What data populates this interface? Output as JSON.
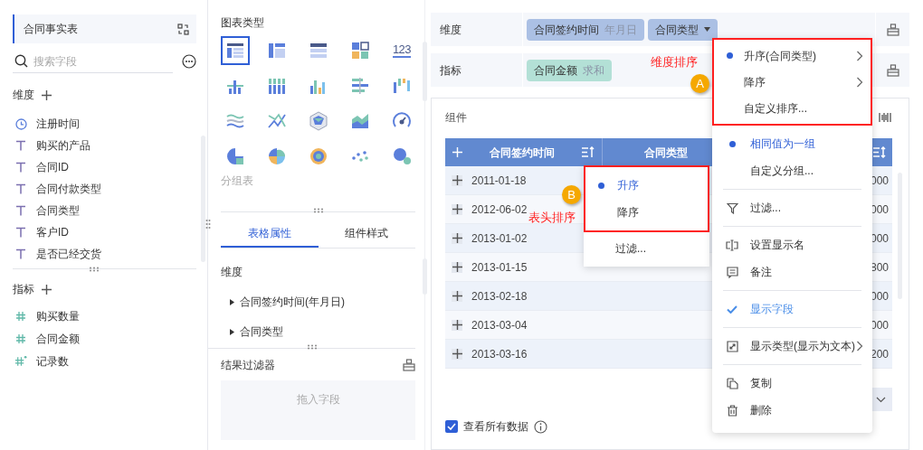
{
  "left_panel": {
    "table_name": "合同事实表",
    "search": {
      "placeholder": "搜索字段"
    },
    "dimensions": {
      "title": "维度",
      "fields": [
        {
          "kind": "date",
          "name": "注册时间"
        },
        {
          "kind": "text",
          "name": "购买的产品"
        },
        {
          "kind": "text",
          "name": "合同ID"
        },
        {
          "kind": "text",
          "name": "合同付款类型"
        },
        {
          "kind": "text",
          "name": "合同类型"
        },
        {
          "kind": "text",
          "name": "客户ID"
        },
        {
          "kind": "text",
          "name": "是否已经交货"
        }
      ]
    },
    "measures": {
      "title": "指标",
      "fields": [
        {
          "kind": "number",
          "name": "购买数量"
        },
        {
          "kind": "number",
          "name": "合同金额"
        },
        {
          "kind": "count",
          "name": "记录数"
        }
      ]
    }
  },
  "chart_types": {
    "title": "图表类型",
    "types": [
      {
        "kind": "table",
        "selected": true
      },
      {
        "kind": "cross-table",
        "selected": false
      },
      {
        "kind": "detail-table",
        "selected": false
      },
      {
        "kind": "kpi-grid",
        "selected": false
      },
      {
        "kind": "number",
        "text": "123",
        "selected": false
      },
      {
        "kind": "grouped-bar",
        "selected": false
      },
      {
        "kind": "stacked-bar",
        "selected": false
      },
      {
        "kind": "multi-bar",
        "selected": false
      },
      {
        "kind": "horizontal-bar",
        "selected": false
      },
      {
        "kind": "waterfall",
        "selected": false
      },
      {
        "kind": "stream",
        "selected": false
      },
      {
        "kind": "line",
        "selected": false
      },
      {
        "kind": "radar",
        "selected": false
      },
      {
        "kind": "area",
        "selected": false
      },
      {
        "kind": "gauge",
        "selected": false
      },
      {
        "kind": "pie",
        "selected": false
      },
      {
        "kind": "rose",
        "selected": false
      },
      {
        "kind": "sunburst",
        "selected": false
      },
      {
        "kind": "scatter",
        "selected": false
      },
      {
        "kind": "bubble",
        "selected": false
      }
    ],
    "caption": "分组表"
  },
  "properties": {
    "tabs": [
      {
        "label": "表格属性",
        "selected": true
      },
      {
        "label": "组件样式",
        "selected": false
      }
    ],
    "section": "维度",
    "fields": [
      "合同签约时间(年月日)",
      "合同类型"
    ]
  },
  "result_filter": {
    "title": "结果过滤器",
    "placeholder": "拖入字段"
  },
  "dimension_row": {
    "label": "维度",
    "pills": [
      {
        "name": "合同签约时间",
        "aggregation": "年月日",
        "dropdown": false
      },
      {
        "name": "合同类型",
        "dropdown": true
      }
    ]
  },
  "measure_row": {
    "label": "指标",
    "pills": [
      {
        "name": "合同金额",
        "aggregation": "求和",
        "dropdown": false
      }
    ]
  },
  "component": {
    "title": "组件",
    "table": {
      "columns": [
        {
          "label": "合同签约时间"
        },
        {
          "label": "合同类型"
        }
      ],
      "rows": [
        {
          "date": "2011-01-18",
          "column_3": "000"
        },
        {
          "date": "2012-06-02",
          "column_3": "000"
        },
        {
          "date": "2013-01-02",
          "column_3": "000"
        },
        {
          "date": "2013-01-15",
          "column_3": "800"
        },
        {
          "date": "2013-02-18",
          "column_3": "000"
        },
        {
          "date": "2013-03-04",
          "column_3": "000"
        },
        {
          "date": "2013-03-16",
          "column_3": "200"
        }
      ]
    },
    "show_all": {
      "label": "查看所有数据",
      "checked": true
    }
  },
  "header_menu": {
    "sort_options": [
      {
        "label": "升序",
        "selected": true
      },
      {
        "label": "降序",
        "selected": false
      }
    ],
    "items": [
      {
        "label": "过滤..."
      }
    ]
  },
  "context_menu": {
    "sort_options": [
      {
        "label": "升序(合同类型)",
        "selected": true,
        "submenu": true
      },
      {
        "label": "降序",
        "selected": false,
        "submenu": true
      },
      {
        "label": "自定义排序...",
        "selected": false,
        "submenu": false
      }
    ],
    "groups": [
      [
        {
          "kind": "radio",
          "label": "相同值为一组",
          "selected": true
        },
        {
          "kind": "radio",
          "label": "自定义分组...",
          "selected": false
        }
      ],
      [
        {
          "kind": "filter",
          "label": "过滤..."
        }
      ],
      [
        {
          "kind": "rename",
          "label": "设置显示名"
        },
        {
          "kind": "note",
          "label": "备注"
        }
      ],
      [
        {
          "kind": "check",
          "label": "显示字段",
          "checked": true
        }
      ],
      [
        {
          "kind": "display-type",
          "label": "显示类型(显示为文本)",
          "submenu": true
        }
      ],
      [
        {
          "kind": "copy",
          "label": "复制"
        },
        {
          "kind": "delete",
          "label": "删除"
        }
      ]
    ]
  },
  "annotations": [
    {
      "label": "维度排序",
      "badge": "A"
    },
    {
      "label": "表头排序",
      "badge": "B"
    }
  ]
}
